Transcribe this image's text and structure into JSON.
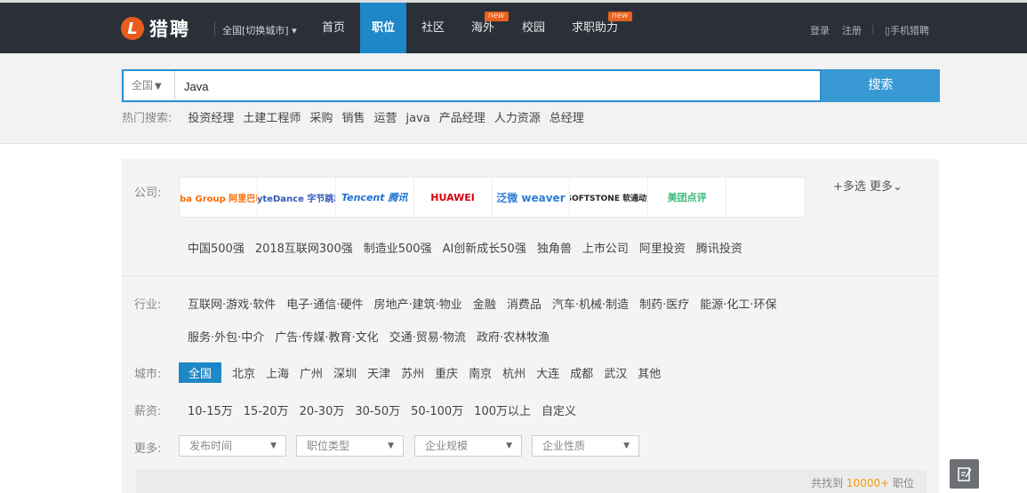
{
  "header": {
    "logo_mark": "L",
    "logo_text": "猎聘",
    "city_switch": "全国[切换城市]",
    "city_switch_arrow": "▾",
    "nav": [
      {
        "label": "首页",
        "active": false
      },
      {
        "label": "职位",
        "active": true
      },
      {
        "label": "社区",
        "active": false
      },
      {
        "label": "海外",
        "active": false,
        "badge": "new"
      },
      {
        "label": "校园",
        "active": false
      },
      {
        "label": "求职助力",
        "active": false,
        "badge": "new"
      }
    ],
    "login": "登录",
    "register": "注册",
    "mobile": "手机猎聘"
  },
  "search": {
    "scope": "全国",
    "scope_arrow": "▼",
    "query": "Java",
    "button": "搜索"
  },
  "hot_searches": {
    "label": "热门搜索:",
    "items": [
      "投资经理",
      "土建工程师",
      "采购",
      "销售",
      "运营",
      "java",
      "产品经理",
      "人力资源",
      "总经理"
    ]
  },
  "company_filter": {
    "label": "公司:",
    "logos": [
      {
        "name": "Alibaba Group 阿里巴巴集团",
        "color": "#ff6a00"
      },
      {
        "name": "ByteDance 字节跳动",
        "color": "#325ab4"
      },
      {
        "name": "Tencent 腾讯",
        "color": "#1e6fd2"
      },
      {
        "name": "HUAWEI",
        "color": "#d7000f"
      },
      {
        "name": "泛微 weaver",
        "color": "#2e7bd6"
      },
      {
        "name": "iSOFTSTONE 软通动力",
        "color": "#222222"
      },
      {
        "name": "美团点评",
        "color": "#3bb878"
      }
    ],
    "multi_select": "+多选",
    "more": "更多⌄",
    "tags": [
      "中国500强",
      "2018互联网300强",
      "制造业500强",
      "AI创新成长50强",
      "独角兽",
      "上市公司",
      "阿里投资",
      "腾讯投资"
    ]
  },
  "industry_filter": {
    "label": "行业:",
    "row1": [
      "互联网·游戏·软件",
      "电子·通信·硬件",
      "房地产·建筑·物业",
      "金融",
      "消费品",
      "汽车·机械·制造",
      "制药·医疗",
      "能源·化工·环保"
    ],
    "row2": [
      "服务·外包·中介",
      "广告·传媒·教育·文化",
      "交通·贸易·物流",
      "政府·农林牧渔"
    ]
  },
  "city_filter": {
    "label": "城市:",
    "items": [
      "全国",
      "北京",
      "上海",
      "广州",
      "深圳",
      "天津",
      "苏州",
      "重庆",
      "南京",
      "杭州",
      "大连",
      "成都",
      "武汉",
      "其他"
    ],
    "active": "全国"
  },
  "salary_filter": {
    "label": "薪资:",
    "items": [
      "10-15万",
      "15-20万",
      "20-30万",
      "30-50万",
      "50-100万",
      "100万以上",
      "自定义"
    ]
  },
  "more_filter": {
    "label": "更多:",
    "dropdowns": [
      "发布时间",
      "职位类型",
      "企业规模",
      "企业性质"
    ],
    "arrow": "▼"
  },
  "result": {
    "prefix": "共找到",
    "count": "10000+",
    "suffix": "职位"
  },
  "feedback_icon": "edit-note-icon"
}
